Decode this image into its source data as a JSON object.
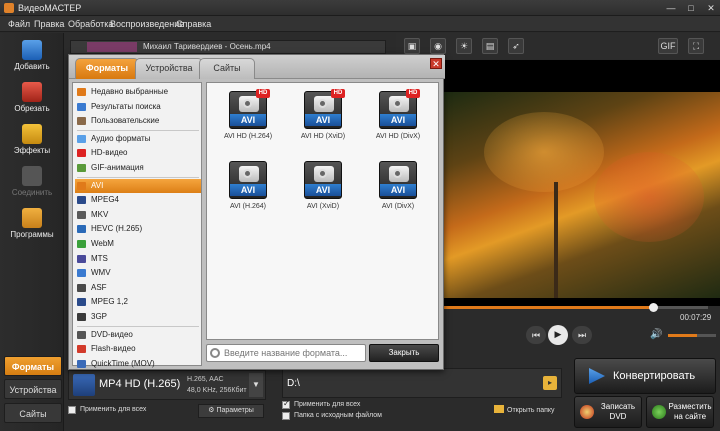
{
  "window": {
    "title": "ВидеоМАСТЕР"
  },
  "menu": [
    "Файл",
    "Правка",
    "Обработка",
    "Воспроизведение",
    "Справка"
  ],
  "sidebar": {
    "buttons": [
      {
        "label": "Добавить",
        "icon": "add-film-icon"
      },
      {
        "label": "Обрезать",
        "icon": "cut-film-icon"
      },
      {
        "label": "Эффекты",
        "icon": "effects-icon"
      },
      {
        "label": "Соединить",
        "icon": "join-icon"
      },
      {
        "label": "Программы",
        "icon": "programs-icon"
      }
    ],
    "tabs": [
      "Форматы",
      "Устройства",
      "Сайты"
    ]
  },
  "file": {
    "name": "Михаил Таривердиев - Осень.mp4"
  },
  "dialog": {
    "tabs": [
      "Форматы",
      "Устройства",
      "Сайты"
    ],
    "close": "✕",
    "categories": [
      "Недавно выбранные",
      "Результаты поиска",
      "Пользовательские",
      "Аудио форматы",
      "HD-видео",
      "GIF-анимация",
      "AVI",
      "MPEG4",
      "MKV",
      "HEVC (H.265)",
      "WebM",
      "MTS",
      "WMV",
      "ASF",
      "MPEG 1,2",
      "3GP",
      "DVD-видео",
      "Flash-видео",
      "QuickTime (MOV)"
    ],
    "selected_category": "AVI",
    "formats": [
      {
        "badge": "AVI",
        "hd": "HD",
        "label": "AVI HD (H.264)"
      },
      {
        "badge": "AVI",
        "hd": "HD",
        "label": "AVI HD (XviD)"
      },
      {
        "badge": "AVI",
        "hd": "HD",
        "label": "AVI HD (DivX)"
      },
      {
        "badge": "AVI",
        "hd": "",
        "label": "AVI (H.264)"
      },
      {
        "badge": "AVI",
        "hd": "",
        "label": "AVI (XviD)"
      },
      {
        "badge": "AVI",
        "hd": "",
        "label": "AVI (DivX)"
      }
    ],
    "search_placeholder": "Введите название формата...",
    "close_button": "Закрыть"
  },
  "player": {
    "timecode": "00:07:29",
    "progress": 0.79,
    "volume": 0.6
  },
  "output": {
    "format_name": "MP4 HD (H.265)",
    "format_info_1": "H.265, AAC",
    "format_info_2": "48,0 KHz, 256Кбит",
    "apply_all": "Применить для всех",
    "params": "Параметры",
    "path": "D:\\",
    "apply_all_path": "Применить для всех",
    "source_folder": "Папка с исходным файлом",
    "open_folder": "Открыть папку"
  },
  "actions": {
    "convert": "Конвертировать",
    "burn_dvd": "Записать DVD",
    "upload": "Разместить на сайте"
  },
  "colors": {
    "accent": "#e07a1a",
    "background": "#2b2b2b",
    "dialog": "#bfbfbf"
  }
}
